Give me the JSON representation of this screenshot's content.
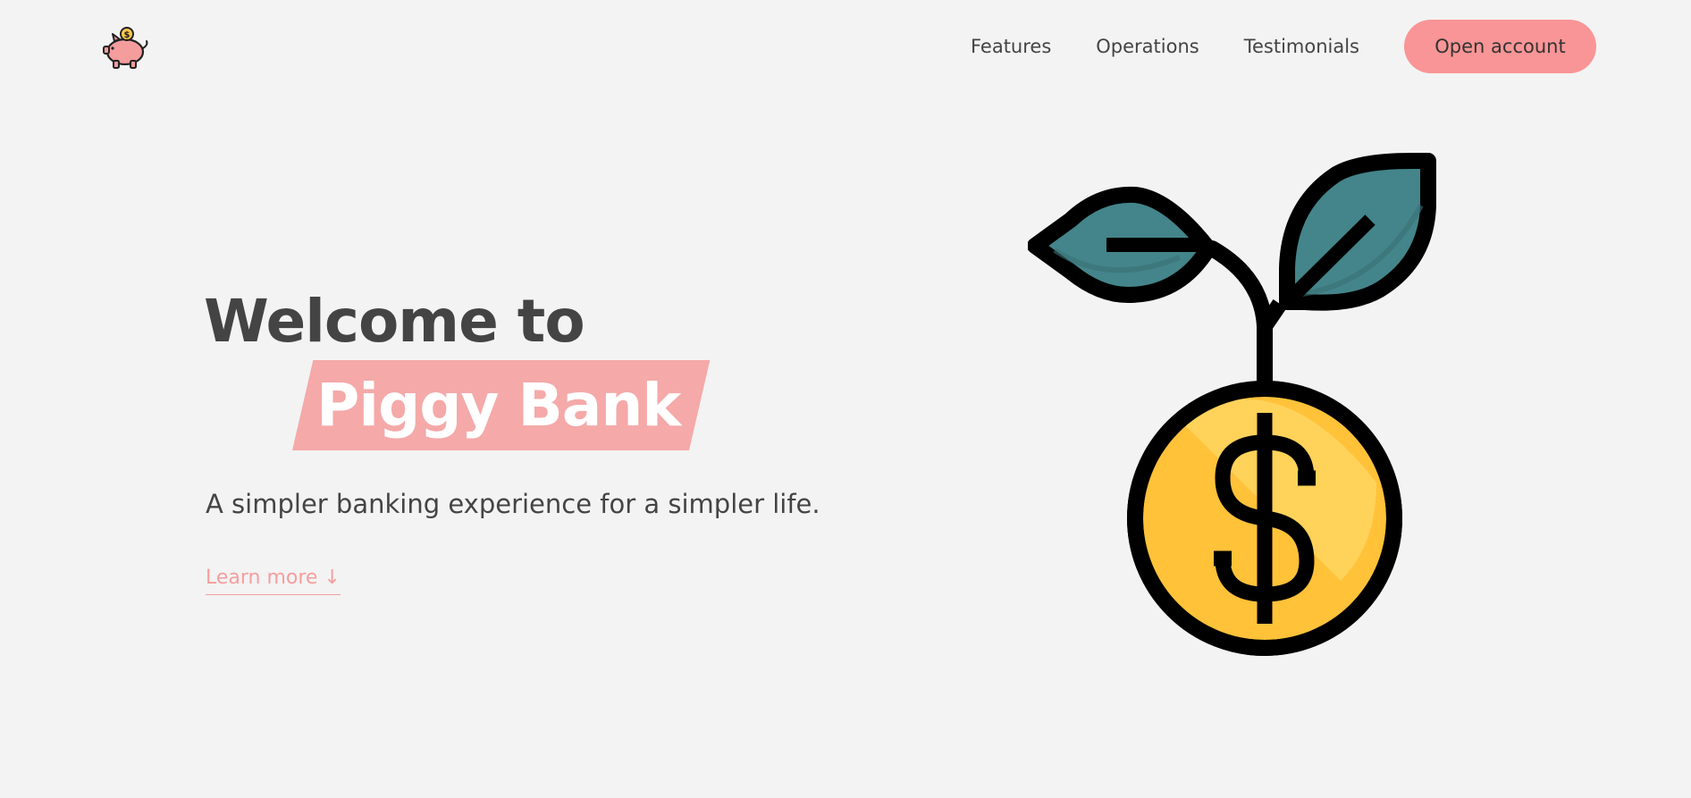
{
  "nav": {
    "logo_icon": "piggy-bank-icon",
    "links": [
      {
        "label": "Features"
      },
      {
        "label": "Operations"
      },
      {
        "label": "Testimonials"
      }
    ],
    "cta_label": "Open account"
  },
  "hero": {
    "title_line1": "Welcome to",
    "title_highlight": "Piggy Bank",
    "subtitle": "A simpler banking experience for a simpler life.",
    "learn_more": "Learn more ↓",
    "illustration_icon": "money-plant-coin-icon"
  },
  "colors": {
    "background": "#f3f3f3",
    "accent": "#f99596",
    "highlight": "#f5a9a9",
    "text": "#444444",
    "leaf": "#43858a",
    "coin": "#ffc239"
  }
}
